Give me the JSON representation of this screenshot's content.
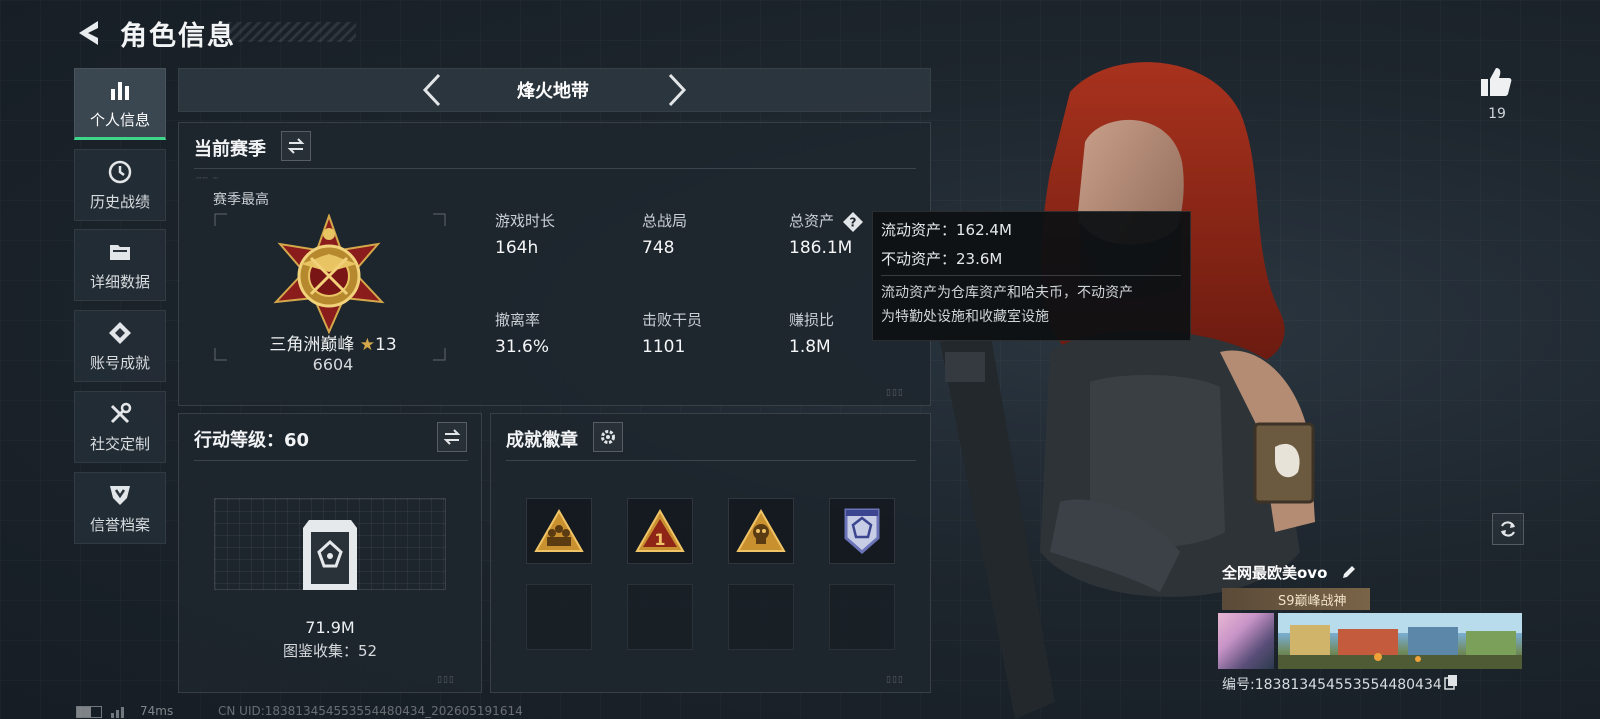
{
  "header": {
    "title": "角色信息"
  },
  "sidebar": {
    "items": [
      {
        "label": "个人信息",
        "icon": "bar-chart-icon",
        "active": true
      },
      {
        "label": "历史战绩",
        "icon": "history-clock-icon"
      },
      {
        "label": "详细数据",
        "icon": "folder-icon"
      },
      {
        "label": "账号成就",
        "icon": "achievement-badge-icon"
      },
      {
        "label": "社交定制",
        "icon": "tools-icon"
      },
      {
        "label": "信誉档案",
        "icon": "reputation-shield-icon"
      }
    ]
  },
  "mode": {
    "label": "烽火地带"
  },
  "season": {
    "title": "当前赛季",
    "best_label": "赛季最高",
    "rank_name": "三角洲巅峰",
    "rank_stars": "13",
    "rank_score": "6604",
    "stats": [
      {
        "label": "游戏时长",
        "value": "164h"
      },
      {
        "label": "总战局",
        "value": "748"
      },
      {
        "label": "总资产",
        "value": "186.1M"
      },
      {
        "label": "撤离率",
        "value": "31.6%"
      },
      {
        "label": "击败干员",
        "value": "1101"
      },
      {
        "label": "赚损比",
        "value": "1.8M"
      }
    ]
  },
  "tooltip": {
    "liquid": "流动资产：162.4M",
    "fixed": "不动资产：23.6M",
    "desc_line1": "流动资产为仓库资产和哈夫币，不动资产",
    "desc_line2": "为特勤处设施和收藏室设施"
  },
  "action_level": {
    "title": "行动等级：60",
    "value": "71.9M",
    "collection": "图鉴收集：52"
  },
  "achievements": {
    "title": "成就徽章",
    "badges": [
      "squad-badge-icon",
      "rank-one-badge-icon",
      "skull-badge-icon",
      "shield-emblem-badge-icon"
    ]
  },
  "profile": {
    "likes": "19",
    "name": "全网最欧美ovo",
    "season_tag": "S9巅峰战神",
    "id_text": "编号:183813454553554480434"
  },
  "status": {
    "ping": "74ms",
    "uid": "CN UID:183813454553554480434_202605191614"
  },
  "colors": {
    "accent": "#3fd58a",
    "gold": "#d4a84a",
    "panel": "#1e262d"
  }
}
